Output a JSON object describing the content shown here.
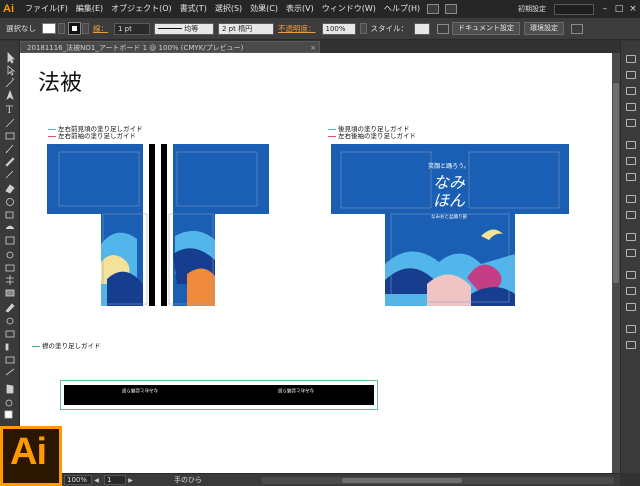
{
  "app": {
    "logo": "Ai",
    "menu": [
      "ファイル(F)",
      "編集(E)",
      "オブジェクト(O)",
      "書式(T)",
      "選択(S)",
      "効果(C)",
      "表示(V)",
      "ウィンドウ(W)",
      "ヘルプ(H)"
    ],
    "workspace": "初期設定",
    "window_controls": [
      "–",
      "□",
      "×"
    ]
  },
  "controlbar": {
    "selection": "選択なし",
    "stroke_label": "線：",
    "stroke_weight": "1 pt",
    "stroke_profile": "均等",
    "brush": "2 pt 楕円",
    "opacity_label": "不透明度：",
    "opacity_value": "100%",
    "style_label": "スタイル：",
    "doc_setup_button": "ドキュメント設定",
    "prefs_button": "環境設定"
  },
  "document": {
    "tab_title": "20181116_法被NO1_アートボード 1 @ 100% (CMYK/プレビュー)"
  },
  "artboard": {
    "title": "法被",
    "front_guides": [
      {
        "text": "左右前見頃の塗り足しガイド",
        "color": "#4fb3e8"
      },
      {
        "text": "左右前袖の塗り足しガイド",
        "color": "#e0508a"
      }
    ],
    "back_guides": [
      {
        "text": "後見頃の塗り足しガイド",
        "color": "#4fb3e8"
      },
      {
        "text": "左右後袖の塗り足しガイド",
        "color": "#e0508a"
      }
    ],
    "collar_guide": {
      "text": "襟の塗り足しガイド",
      "color": "#3cb371"
    },
    "back_motto": "笑顔と踊ろう。",
    "back_logo_line1": "なみ",
    "back_logo_line2": "ほん",
    "back_sub": "なみおと盆踊り部",
    "collar_left_text": "なみおと盆踊り部",
    "collar_right_text": "なみおと盆踊り部",
    "colors": {
      "blue": "#1a5fb4",
      "navy": "#173d8f",
      "sky": "#52b6ea",
      "cream": "#f4e29a",
      "orange": "#f08a3c",
      "pink": "#efc4c4",
      "magenta": "#c43e86"
    }
  },
  "statusbar": {
    "zoom": "100%",
    "page": "1",
    "tool": "手のひら"
  }
}
